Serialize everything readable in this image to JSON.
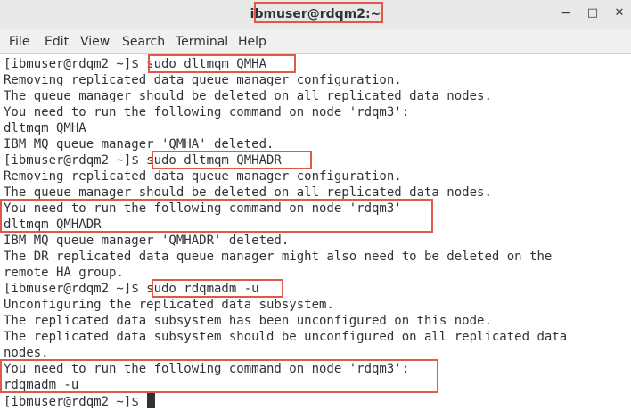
{
  "window": {
    "title": "ibmuser@rdqm2:~",
    "minimize_glyph": "−",
    "maximize_glyph": "□",
    "close_glyph": "✕"
  },
  "menu": [
    "File",
    "Edit",
    "View",
    "Search",
    "Terminal",
    "Help"
  ],
  "terminal": {
    "prompt": "[ibmuser@rdqm2 ~]$ ",
    "lines": [
      "[ibmuser@rdqm2 ~]$ sudo dltmqm QMHA",
      "Removing replicated data queue manager configuration.",
      "The queue manager should be deleted on all replicated data nodes.",
      "You need to run the following command on node 'rdqm3':",
      "dltmqm QMHA",
      "IBM MQ queue manager 'QMHA' deleted.",
      "[ibmuser@rdqm2 ~]$ sudo dltmqm QMHADR",
      "Removing replicated data queue manager configuration.",
      "The queue manager should be deleted on all replicated data nodes.",
      "You need to run the following command on node 'rdqm3'",
      "dltmqm QMHADR",
      "IBM MQ queue manager 'QMHADR' deleted.",
      "The DR replicated data queue manager might also need to be deleted on the",
      "remote HA group.",
      "[ibmuser@rdqm2 ~]$ sudo rdqmadm -u",
      "Unconfiguring the replicated data subsystem.",
      "The replicated data subsystem has been unconfigured on this node.",
      "The replicated data subsystem should be unconfigured on all replicated data",
      "nodes.",
      "You need to run the following command on node 'rdqm3':",
      "rdqmadm -u"
    ]
  }
}
